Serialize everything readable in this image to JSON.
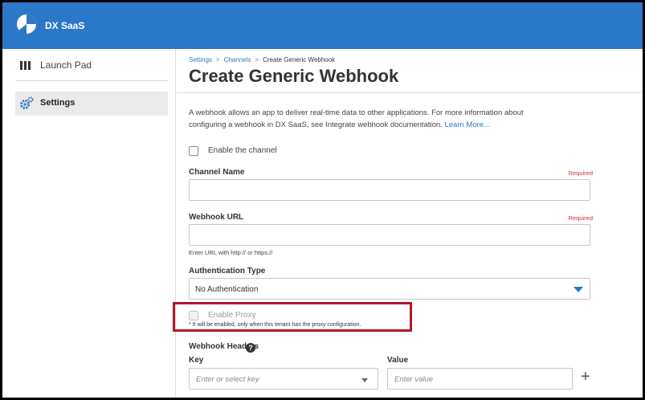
{
  "app": {
    "title": "DX SaaS"
  },
  "sidebar": {
    "items": [
      {
        "label": "Launch Pad",
        "icon": "launch-pad-icon"
      },
      {
        "label": "Settings",
        "icon": "gear-icon",
        "active": true
      }
    ]
  },
  "breadcrumb": {
    "items": [
      "Settings",
      "Channels",
      "Create Generic Webhook"
    ],
    "separator": ">"
  },
  "page": {
    "title": "Create Generic Webhook",
    "description_line1": "A webhook allows an app to deliver real-time data to other applications. For more information about",
    "description_line2": "configuring a webhook in DX SaaS, see Integrate webhook documentation.",
    "learn_more": "Learn More..."
  },
  "form": {
    "enable_channel_label": "Enable the channel",
    "channel_name": {
      "label": "Channel Name",
      "required": "Required",
      "value": ""
    },
    "webhook_url": {
      "label": "Webhook URL",
      "required": "Required",
      "value": "",
      "hint": "Enter URL with http:// or https://"
    },
    "auth_type": {
      "label": "Authentication Type",
      "selected": "No Authentication"
    },
    "enable_proxy": {
      "label": "Enable Proxy",
      "note": "* It will be enabled, only when this tenant has the proxy configuration."
    },
    "webhook_headers": {
      "label": "Webhook Headers",
      "key_label": "Key",
      "value_label": "Value",
      "key_placeholder": "Enter or select key",
      "value_placeholder": "Enter value",
      "add_symbol": "+"
    }
  },
  "colors": {
    "brand": "#2b78c8",
    "required": "#d13438",
    "highlight": "#b5152b"
  }
}
